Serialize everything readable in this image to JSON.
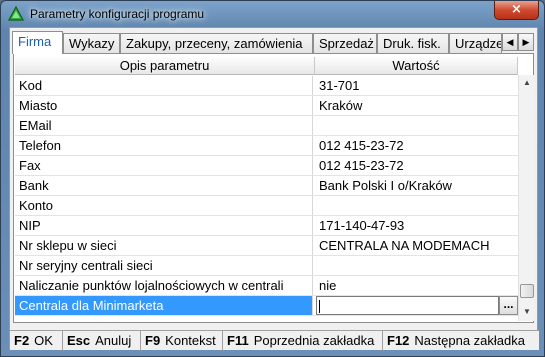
{
  "window": {
    "title": "Parametry konfiguracji programu",
    "close_glyph": "×",
    "icon": "green-triangle-icon"
  },
  "tabs": [
    {
      "label": "Firma",
      "active": true
    },
    {
      "label": "Wykazy",
      "active": false
    },
    {
      "label": "Zakupy, przeceny, zamówienia",
      "active": false
    },
    {
      "label": "Sprzedaż",
      "active": false
    },
    {
      "label": "Druk. fisk.",
      "active": false
    },
    {
      "label": "Urządzenia",
      "active": false
    }
  ],
  "tab_scroll": {
    "left": "◀",
    "right": "▶"
  },
  "grid": {
    "col_param": "Opis parametru",
    "col_value": "Wartość",
    "rows": [
      {
        "param": "Kod",
        "value": "31-701"
      },
      {
        "param": "Miasto",
        "value": "Kraków"
      },
      {
        "param": "EMail",
        "value": ""
      },
      {
        "param": "Telefon",
        "value": "012 415-23-72"
      },
      {
        "param": "Fax",
        "value": "012 415-23-72"
      },
      {
        "param": "Bank",
        "value": "Bank Polski I o/Kraków"
      },
      {
        "param": "Konto",
        "value": ""
      },
      {
        "param": "NIP",
        "value": "171-140-47-93"
      },
      {
        "param": "Nr sklepu w sieci",
        "value": "CENTRALA NA MODEMACH"
      },
      {
        "param": "Nr seryjny centrali sieci",
        "value": ""
      },
      {
        "param": "Naliczanie punktów lojalnościowych w centrali",
        "value": "nie"
      },
      {
        "param": "Centrala dla Minimarketa",
        "value": ""
      }
    ],
    "ellipsis": "..."
  },
  "scrollbar": {
    "up": "▲",
    "down": "▼"
  },
  "statusbar": [
    {
      "key": "F2",
      "label": "OK"
    },
    {
      "key": "Esc",
      "label": "Anuluj"
    },
    {
      "key": "F9",
      "label": "Kontekst"
    },
    {
      "key": "F11",
      "label": "Poprzednia zakładka"
    },
    {
      "key": "F12",
      "label": "Następna zakładka"
    }
  ]
}
